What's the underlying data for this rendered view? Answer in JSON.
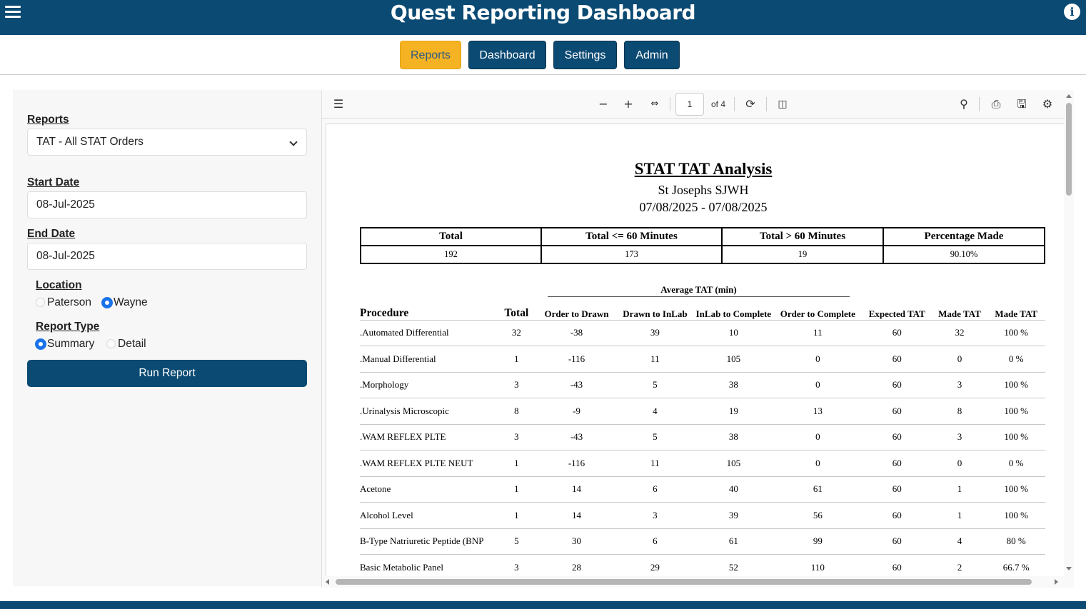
{
  "header": {
    "title": "Quest Reporting Dashboard"
  },
  "nav": {
    "reports": "Reports",
    "dashboard": "Dashboard",
    "settings": "Settings",
    "admin": "Admin"
  },
  "form": {
    "reports_label": "Reports",
    "reports_value": "TAT - All STAT Orders",
    "start_label": "Start Date",
    "start_value": "08-Jul-2025",
    "end_label": "End Date",
    "end_value": "08-Jul-2025",
    "location_label": "Location",
    "location_options": [
      "Paterson",
      "Wayne"
    ],
    "location_selected": "Wayne",
    "type_label": "Report Type",
    "type_options": [
      "Summary",
      "Detail"
    ],
    "type_selected": "Summary",
    "run_label": "Run Report"
  },
  "viewer": {
    "page": "1",
    "page_of": "of 4"
  },
  "report": {
    "title": "STAT TAT Analysis",
    "site": "St Josephs SJWH",
    "date_range": "07/08/2025 - 07/08/2025",
    "summary_headers": [
      "Total",
      "Total <= 60 Minutes",
      "Total > 60 Minutes",
      "Percentage Made"
    ],
    "summary_values": [
      "192",
      "173",
      "19",
      "90.10%"
    ],
    "avg_label": "Average TAT (min)",
    "columns": [
      "Procedure",
      "Total",
      "Order to Drawn",
      "Drawn to InLab",
      "InLab to Complete",
      "Order to Complete",
      "Expected TAT",
      "Made TAT",
      "Made TAT"
    ],
    "rows": [
      [
        ".Automated Differential",
        "32",
        "-38",
        "39",
        "10",
        "11",
        "60",
        "32",
        "100 %"
      ],
      [
        ".Manual Differential",
        "1",
        "-116",
        "11",
        "105",
        "0",
        "60",
        "0",
        "0 %"
      ],
      [
        ".Morphology",
        "3",
        "-43",
        "5",
        "38",
        "0",
        "60",
        "3",
        "100 %"
      ],
      [
        ".Urinalysis Microscopic",
        "8",
        "-9",
        "4",
        "19",
        "13",
        "60",
        "8",
        "100 %"
      ],
      [
        ".WAM REFLEX PLTE",
        "3",
        "-43",
        "5",
        "38",
        "0",
        "60",
        "3",
        "100 %"
      ],
      [
        ".WAM REFLEX PLTE NEUT",
        "1",
        "-116",
        "11",
        "105",
        "0",
        "60",
        "0",
        "0 %"
      ],
      [
        "Acetone",
        "1",
        "14",
        "6",
        "40",
        "61",
        "60",
        "1",
        "100 %"
      ],
      [
        "Alcohol Level",
        "1",
        "14",
        "3",
        "39",
        "56",
        "60",
        "1",
        "100 %"
      ],
      [
        "B-Type Natriuretic Peptide (BNP",
        "5",
        "30",
        "6",
        "61",
        "99",
        "60",
        "4",
        "80 %"
      ],
      [
        "Basic Metabolic Panel",
        "3",
        "28",
        "29",
        "52",
        "110",
        "60",
        "2",
        "66.7 %"
      ]
    ]
  }
}
